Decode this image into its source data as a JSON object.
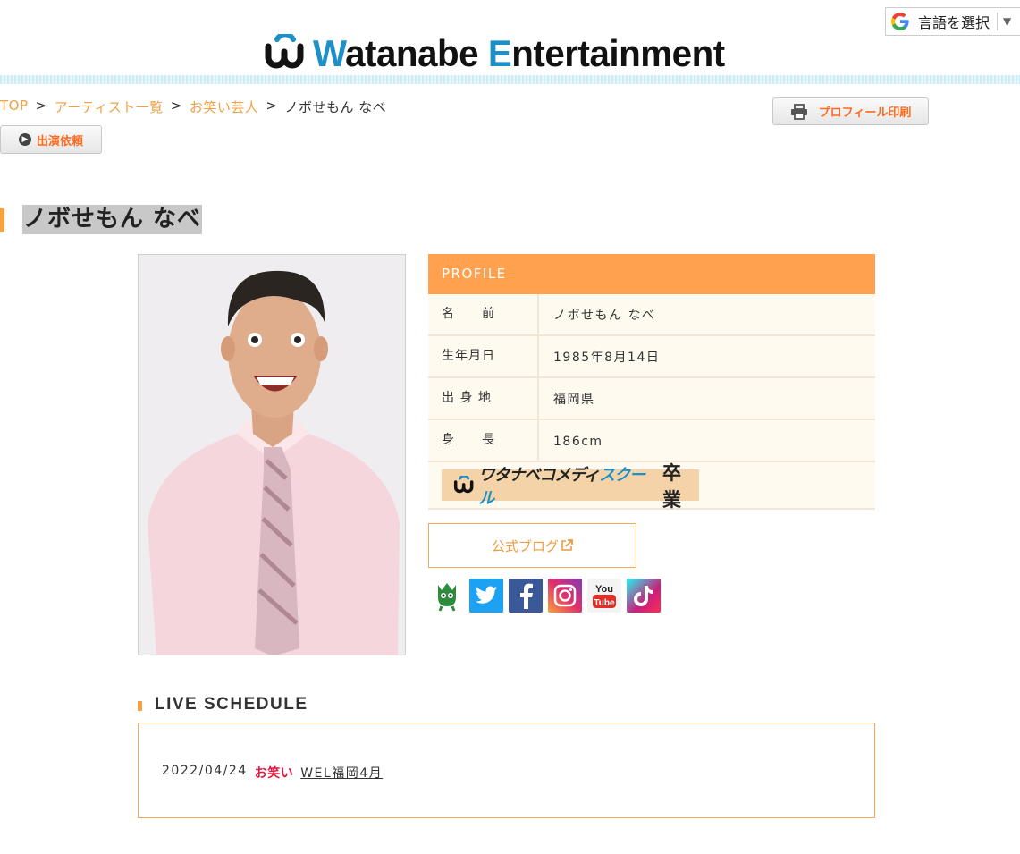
{
  "translate": {
    "label": "言語を選択",
    "arrow": "▼"
  },
  "header": {
    "logo_part1": "W",
    "logo_part1b": "atanabe ",
    "logo_part2": "E",
    "logo_part2b": "ntertainment"
  },
  "breadcrumb": {
    "items": [
      "TOP",
      "アーティスト一覧",
      "お笑い芸人"
    ],
    "current": "ノボせもん なべ",
    "separator": ">"
  },
  "buttons": {
    "print": "プロフィール印刷",
    "appearance": "出演依頼"
  },
  "page_title": "ノボせもん なべ",
  "profile": {
    "heading": "PROFILE",
    "rows": [
      {
        "key": "名　　前",
        "value": "ノボせもん なべ"
      },
      {
        "key": "生年月日",
        "value": "1985年8月14日"
      },
      {
        "key": "出 身 地",
        "value": "福岡県"
      },
      {
        "key": "身　　長",
        "value": "186cm"
      }
    ],
    "school_badge": {
      "text1": "ワタナベコメディ",
      "text2": "スクール",
      "grad": "卒業"
    }
  },
  "blog_button": "公式ブログ",
  "social_icons": [
    "ameba-icon",
    "twitter-icon",
    "facebook-icon",
    "instagram-icon",
    "youtube-icon",
    "tiktok-icon"
  ],
  "live_schedule": {
    "title": "LIVE SCHEDULE",
    "items": [
      {
        "date": "2022/04/24",
        "tag": "お笑い",
        "event": "WEL福岡4月"
      }
    ]
  },
  "colors": {
    "accent_orange": "#ffa14f",
    "link_orange": "#f0a046",
    "brand_blue": "#1e90c8",
    "tag_red": "#e8143c"
  }
}
